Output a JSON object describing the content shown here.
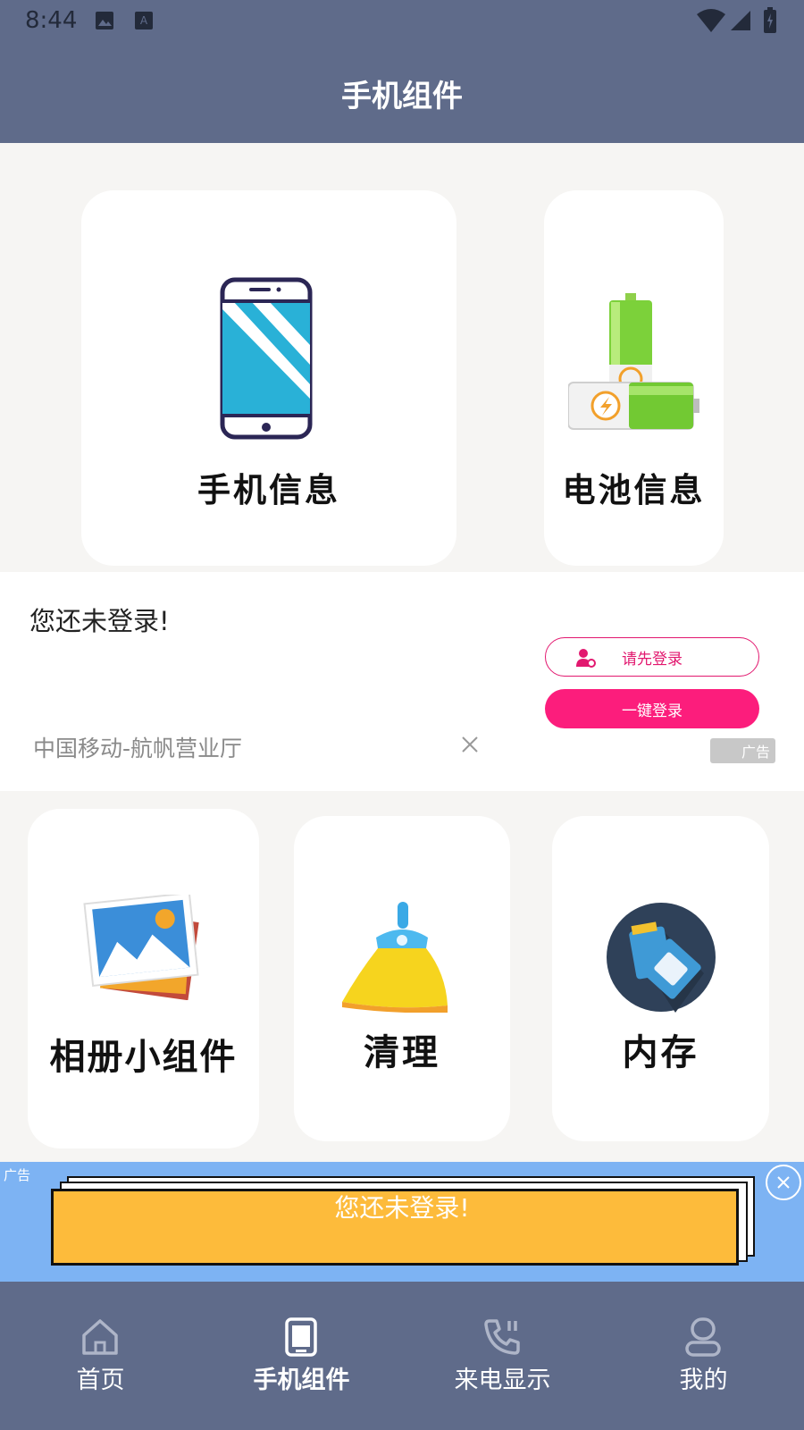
{
  "status_bar": {
    "time": "8:44"
  },
  "header": {
    "title": "手机组件"
  },
  "cards_top": [
    {
      "label": "手机信息",
      "icon": "phone-icon"
    },
    {
      "label": "电池信息",
      "icon": "battery-icon"
    }
  ],
  "ad": {
    "message": "您还未登录!",
    "login_button": "请先登录",
    "one_click_button": "一键登录",
    "source": "中国移动-航帆营业厅",
    "badge": "广告"
  },
  "cards_bottom": [
    {
      "label": "相册小组件",
      "icon": "photo-album-icon"
    },
    {
      "label": "清理",
      "icon": "broom-icon"
    },
    {
      "label": "内存",
      "icon": "sd-card-icon"
    }
  ],
  "banner": {
    "text": "您还未登录!",
    "badge": "广告"
  },
  "tabs": [
    {
      "label": "首页",
      "icon": "home-icon",
      "active": false
    },
    {
      "label": "手机组件",
      "icon": "phone-icon",
      "active": true
    },
    {
      "label": "来电显示",
      "icon": "phone-call-icon",
      "active": false
    },
    {
      "label": "我的",
      "icon": "user-icon",
      "active": false
    }
  ],
  "colors": {
    "header": "#5f6b8a",
    "accent": "#fc1d7c",
    "banner_bg": "#7db3f3",
    "banner_paper": "#fdbb3b"
  }
}
